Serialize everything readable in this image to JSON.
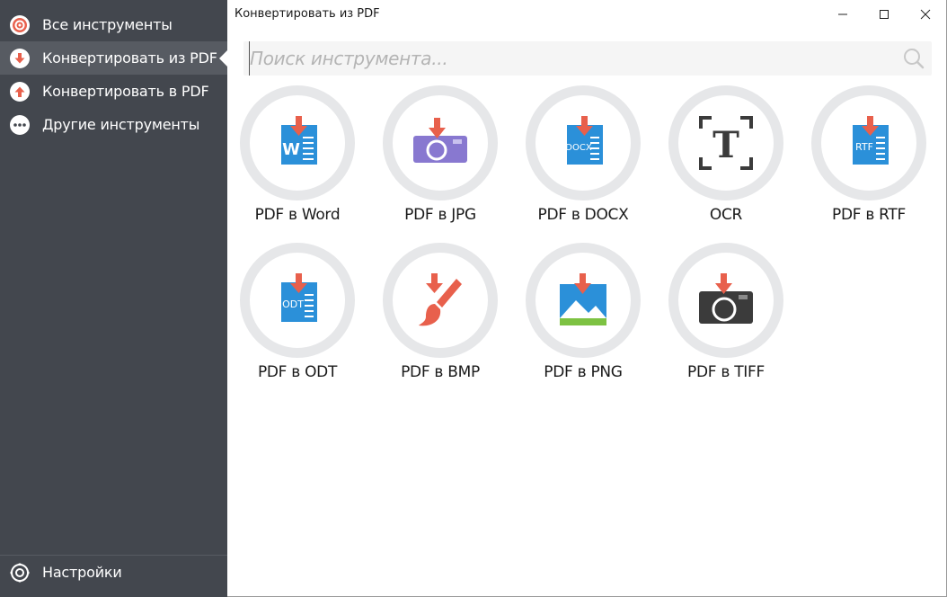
{
  "sidebar": {
    "items": [
      {
        "label": "Все инструменты",
        "icon": "target-icon"
      },
      {
        "label": "Конвертировать из PDF",
        "icon": "arrow-down-icon"
      },
      {
        "label": "Конвертировать в PDF",
        "icon": "arrow-up-icon"
      },
      {
        "label": "Другие инструменты",
        "icon": "more-dots-icon"
      }
    ],
    "settings_label": "Настройки",
    "active_index": 1
  },
  "window": {
    "title": "Конвертировать из PDF"
  },
  "search": {
    "placeholder": "Поиск инструмента..."
  },
  "tools": [
    {
      "label": "PDF в Word",
      "icon": "word-doc-icon",
      "badge": "W"
    },
    {
      "label": "PDF в JPG",
      "icon": "jpg-camera-icon"
    },
    {
      "label": "PDF в DOCX",
      "icon": "docx-doc-icon",
      "badge": "DOCX"
    },
    {
      "label": "OCR",
      "icon": "ocr-text-icon",
      "badge": "T"
    },
    {
      "label": "PDF в RTF",
      "icon": "rtf-doc-icon",
      "badge": "RTF"
    },
    {
      "label": "PDF в ODT",
      "icon": "odt-doc-icon",
      "badge": "ODT"
    },
    {
      "label": "PDF в BMP",
      "icon": "bmp-brush-icon"
    },
    {
      "label": "PDF в PNG",
      "icon": "png-image-icon"
    },
    {
      "label": "PDF в TIFF",
      "icon": "tiff-camera-icon"
    }
  ],
  "colors": {
    "sidebar_bg": "#43474e",
    "sidebar_active": "#575b62",
    "accent_red": "#e8604c",
    "doc_blue": "#2b90d9",
    "jpg_purple": "#8878d0",
    "ring_gray": "#e6e7e9"
  }
}
